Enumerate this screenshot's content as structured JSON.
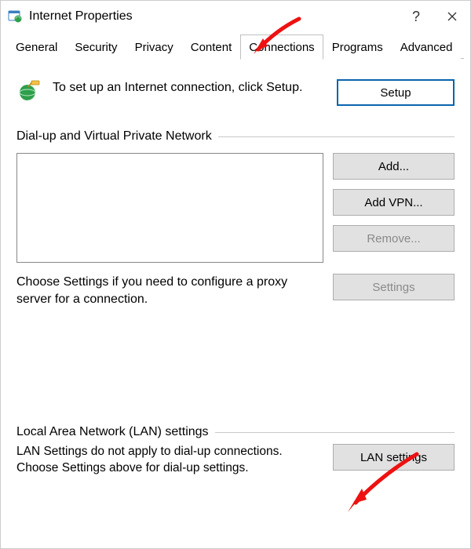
{
  "window": {
    "title": "Internet Properties"
  },
  "tabs": {
    "items": [
      {
        "label": "General"
      },
      {
        "label": "Security"
      },
      {
        "label": "Privacy"
      },
      {
        "label": "Content"
      },
      {
        "label": "Connections"
      },
      {
        "label": "Programs"
      },
      {
        "label": "Advanced"
      }
    ],
    "active_index": 4
  },
  "setup": {
    "text": "To set up an Internet connection, click Setup.",
    "button": "Setup"
  },
  "dialup": {
    "heading": "Dial-up and Virtual Private Network",
    "buttons": {
      "add": "Add...",
      "add_vpn": "Add VPN...",
      "remove": "Remove...",
      "settings": "Settings"
    },
    "proxy_text": "Choose Settings if you need to configure a proxy server for a connection."
  },
  "lan": {
    "heading": "Local Area Network (LAN) settings",
    "text": "LAN Settings do not apply to dial-up connections. Choose Settings above for dial-up settings.",
    "button": "LAN settings"
  }
}
